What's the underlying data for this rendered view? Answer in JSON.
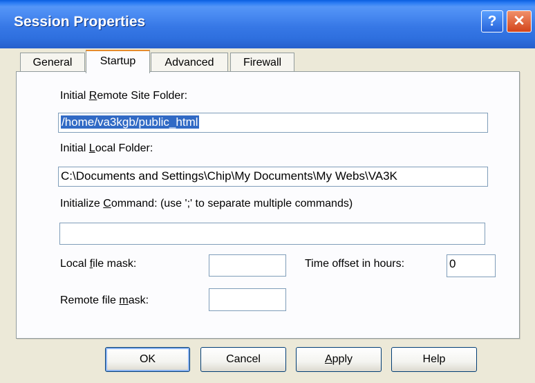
{
  "window": {
    "title": "Session Properties",
    "help_label": "?",
    "close_label": "✕"
  },
  "tabs": [
    {
      "label": "General"
    },
    {
      "label": "Startup"
    },
    {
      "label": "Advanced"
    },
    {
      "label": "Firewall"
    }
  ],
  "active_tab": "Startup",
  "startup": {
    "remote_folder_label_pre": "Initial ",
    "remote_folder_label_key": "R",
    "remote_folder_label_post": "emote Site Folder:",
    "remote_folder_value": "/home/va3kgb/public_html",
    "local_folder_label_pre": "Initial ",
    "local_folder_label_key": "L",
    "local_folder_label_post": "ocal Folder:",
    "local_folder_value": "C:\\Documents and Settings\\Chip\\My Documents\\My Webs\\VA3K",
    "init_cmd_label_pre": "Initialize ",
    "init_cmd_label_key": "C",
    "init_cmd_label_post": "ommand: (use ';' to separate multiple commands)",
    "init_cmd_value": "",
    "local_mask_label_pre": "Local ",
    "local_mask_label_key": "f",
    "local_mask_label_post": "ile mask:",
    "local_mask_value": "",
    "time_offset_label": "Time offset in hours:",
    "time_offset_value": "0",
    "remote_mask_label_pre": "Remote file ",
    "remote_mask_label_key": "m",
    "remote_mask_label_post": "ask:",
    "remote_mask_value": ""
  },
  "buttons": {
    "ok": "OK",
    "cancel": "Cancel",
    "apply_key": "A",
    "apply_rest": "pply",
    "help": "Help"
  },
  "colors": {
    "titlebar": "#2e6fde",
    "selection": "#316ac5",
    "active_tab_accent": "#e68b2c"
  }
}
